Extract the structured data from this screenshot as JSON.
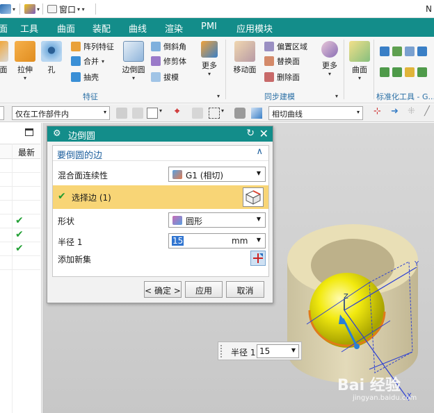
{
  "title_strip": {
    "window_menu": "窗口",
    "edge_text": "N"
  },
  "menu_bar": {
    "items": [
      "面",
      "工具",
      "曲面",
      "装配",
      "曲线",
      "渲染",
      "PMI",
      "应用模块"
    ]
  },
  "ribbon": {
    "feature": {
      "face_label": "面",
      "extrude_label": "拉伸",
      "hole_label": "孔",
      "pattern_feature": "阵列特征",
      "unite": "合并",
      "shell": "抽壳",
      "edge_blend": "边倒圆",
      "chamfer": "倒斜角",
      "trim_body": "修剪体",
      "draft": "拔模",
      "more": "更多",
      "group_label": "特征"
    },
    "sync": {
      "move_face": "移动面",
      "offset_region": "偏置区域",
      "replace_face": "替换面",
      "delete_face": "删除面",
      "more": "更多",
      "group_label": "同步建模"
    },
    "surface": {
      "surface_label": "曲面",
      "group_label": "标准化工具 - G..."
    }
  },
  "selection_bar": {
    "scope_value": "仅在工作部件内",
    "curve_rule_value": "相切曲线"
  },
  "navigator": {
    "column_header": "最新",
    "checked_rows": 3
  },
  "dialog": {
    "title": "边倒圆",
    "section_title": "要倒圆的边",
    "continuity_label": "混合面连续性",
    "continuity_value": "G1 (相切)",
    "select_edge_label": "选择边 (1)",
    "shape_label": "形状",
    "shape_value": "圆形",
    "radius_label": "半径 1",
    "radius_value": "15",
    "radius_unit": "mm",
    "add_set_label": "添加新集",
    "ok_label": "< 确定 >",
    "apply_label": "应用",
    "cancel_label": "取消"
  },
  "float_radius": {
    "label": "半径 1",
    "value": "15"
  },
  "viewport": {
    "axis_z": "Z",
    "axis_y": "Y",
    "axis_x": "X",
    "watermark_brand": "Bai 经验",
    "watermark_url": "jingyan.baidu.com"
  },
  "colors": {
    "accent_teal": "#138d8a",
    "selection_yellow": "#f8d576",
    "check_green": "#22a035",
    "group_label_blue": "#2a6fa5"
  }
}
